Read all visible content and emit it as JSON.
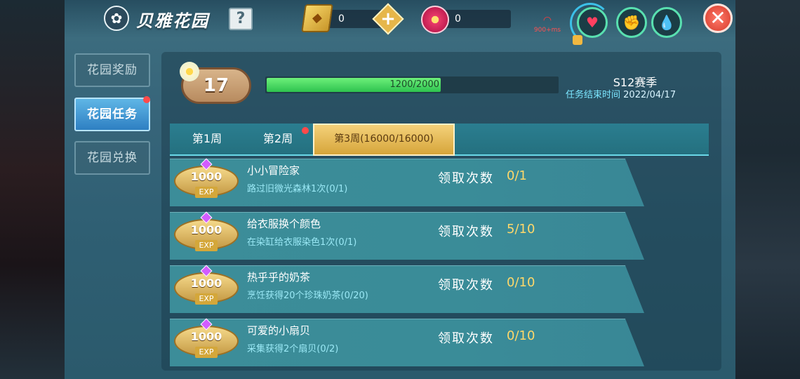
{
  "header": {
    "title": "贝雅花园",
    "help": "?",
    "gold_count": "0",
    "flower_count": "0",
    "signal": "900+ms",
    "close": "✕"
  },
  "sidebar": {
    "items": [
      {
        "label": "花园奖励"
      },
      {
        "label": "花园任务"
      },
      {
        "label": "花园兑换"
      }
    ]
  },
  "level": {
    "value": "17",
    "progress_text": "1200/2000",
    "progress_fraction": 0.6
  },
  "season": {
    "title": "S12赛季",
    "end_label": "任务结束时间",
    "end_date": "2022/04/17"
  },
  "weeks": [
    {
      "label": "第1周"
    },
    {
      "label": "第2周"
    },
    {
      "label": "第3周(16000/16000)"
    }
  ],
  "tasks": [
    {
      "reward": "1000",
      "exp": "EXP",
      "name": "小小冒险家",
      "desc": "路过旧微光森林1次(0/1)",
      "claim_label": "领取次数",
      "claim_count": "0/1"
    },
    {
      "reward": "1000",
      "exp": "EXP",
      "name": "给衣服换个颜色",
      "desc": "在染缸给衣服染色1次(0/1)",
      "claim_label": "领取次数",
      "claim_count": "5/10"
    },
    {
      "reward": "1000",
      "exp": "EXP",
      "name": "热乎乎的奶茶",
      "desc": "烹饪获得20个珍珠奶茶(0/20)",
      "claim_label": "领取次数",
      "claim_count": "0/10"
    },
    {
      "reward": "1000",
      "exp": "EXP",
      "name": "可爱的小扇贝",
      "desc": "采集获得2个扇贝(0/2)",
      "claim_label": "领取次数",
      "claim_count": "0/10"
    }
  ],
  "icons": {
    "title_icon": "flower-icon",
    "gold_icon": "gold-ticket-icon",
    "flower_icon": "flower-coin-icon",
    "stats": [
      "heart-icon",
      "arm-strength-icon",
      "water-drop-icon"
    ]
  },
  "colors": {
    "accent_gold": "#ffd86a",
    "progress_green": "#2ec34f",
    "active_tab_blue": "#2e7fc2"
  }
}
